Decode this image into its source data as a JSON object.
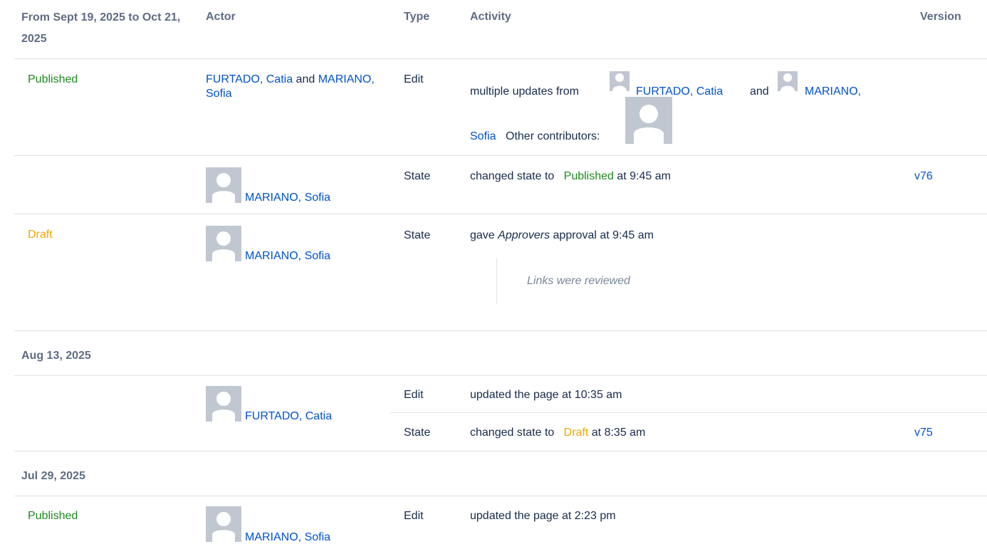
{
  "header": {
    "date_range": "From Sept 19, 2025 to Oct 21, 2025",
    "actor": "Actor",
    "type": "Type",
    "activity": "Activity",
    "version": "Version"
  },
  "rows": {
    "r1": {
      "status": "Published",
      "actor_a": "FURTADO, Catia",
      "and": "and",
      "actor_b": "MARIANO, Sofia",
      "type": "Edit",
      "activity_prefix": "multiple updates from",
      "activity_actor_a": "FURTADO, Catia",
      "activity_and": "and",
      "activity_actor_b": "MARIANO,",
      "activity_actor_b2": "Sofia",
      "activity_other": "Other contributors:"
    },
    "r2": {
      "actor": "MARIANO, Sofia",
      "type": "State",
      "activity_prefix": "changed state to",
      "activity_state": "Published",
      "activity_suffix": "at 9:45 am",
      "version": "v76"
    },
    "r3": {
      "status": "Draft",
      "actor": "MARIANO, Sofia",
      "type": "State",
      "activity_prefix": "gave",
      "activity_group": "Approvers",
      "activity_suffix": "approval at 9:45 am",
      "comment": "Links were reviewed"
    },
    "g2": {
      "date": "Aug 13, 2025"
    },
    "r4": {
      "actor": "FURTADO, Catia",
      "type": "Edit",
      "activity": "updated the page at 10:35 am"
    },
    "r5": {
      "type": "State",
      "activity_prefix": "changed state to",
      "activity_state": "Draft",
      "activity_suffix": "at 8:35 am",
      "version": "v75"
    },
    "g3": {
      "date": "Jul 29, 2025"
    },
    "r6": {
      "status": "Published",
      "actor": "MARIANO, Sofia",
      "type": "Edit",
      "activity": "updated the page at 2:23 pm"
    }
  },
  "colors": {
    "link": "#0052cc",
    "published": "#1d8a1d",
    "draft": "#f2a600",
    "header": "#5e6c84",
    "divider": "#dfe1e6",
    "avatar_bg": "#c1c7d0"
  }
}
